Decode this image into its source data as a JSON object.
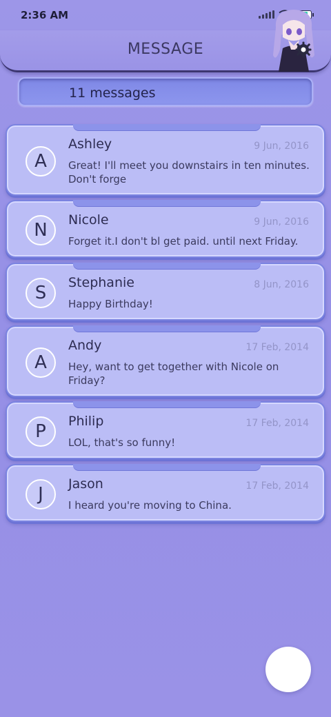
{
  "status": {
    "time": "2:36 AM"
  },
  "header": {
    "title": "MESSAGE"
  },
  "summary": {
    "count_label": "11 messages"
  },
  "messages": [
    {
      "initial": "A",
      "name": "Ashley",
      "date": "9 Jun, 2016",
      "text": "Great! I'll meet you downstairs in ten minutes. Don't forge"
    },
    {
      "initial": "N",
      "name": "Nicole",
      "date": "9 Jun, 2016",
      "text": "Forget it.I don't bl get paid. until next Friday."
    },
    {
      "initial": "S",
      "name": "Stephanie",
      "date": "8 Jun, 2016",
      "text": "Happy Birthday!"
    },
    {
      "initial": "A",
      "name": "Andy",
      "date": "17 Feb, 2014",
      "text": "Hey, want to get together with Nicole on Friday?"
    },
    {
      "initial": "P",
      "name": "Philip",
      "date": "17 Feb, 2014",
      "text": "LOL, that's so funny!"
    },
    {
      "initial": "J",
      "name": "Jason",
      "date": "17 Feb, 2014",
      "text": "I heard you're moving to China."
    }
  ],
  "icons": {
    "signal": "signal-bars-icon",
    "wifi": "wifi-icon",
    "battery": "battery-icon",
    "settings": "gear-icon",
    "compose": "compose-button"
  },
  "colors": {
    "background": "#9d96e8",
    "card": "#bbbdf6",
    "card_border": "#7a83e0",
    "count_bar": "#8891ec",
    "battery_fill": "#33d6b1",
    "fab": "#ffffff"
  }
}
